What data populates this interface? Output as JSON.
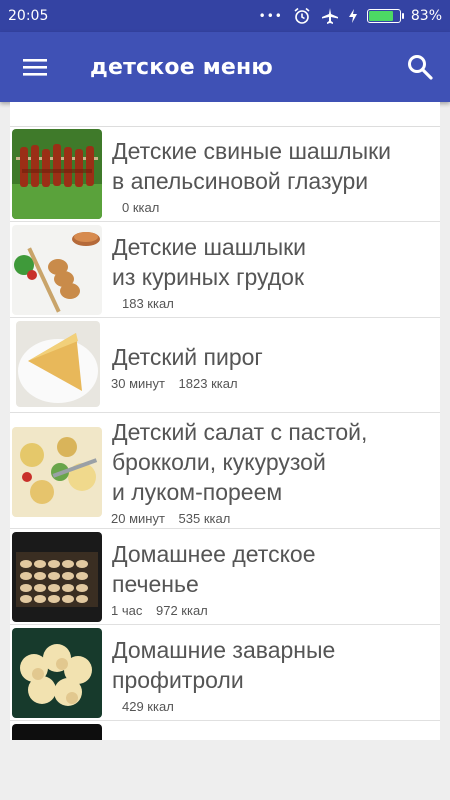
{
  "status": {
    "time": "20:05",
    "dots": "•••",
    "battery": "83%",
    "battery_level": 0.83
  },
  "appbar": {
    "title": "детское меню",
    "menu_icon": "hamburger-menu-icon",
    "search_icon": "search-icon"
  },
  "recipes": [
    {
      "name_line1": "Детские свиные шашлыки",
      "name_line2": "в апельсиновой глазури",
      "name_line3": "",
      "time": "",
      "kcal": "0 ккал"
    },
    {
      "name_line1": "Детские шашлыки",
      "name_line2": "из куриных грудок",
      "name_line3": "",
      "time": "",
      "kcal": "183 ккал"
    },
    {
      "name_line1": "Детский пирог",
      "name_line2": "",
      "name_line3": "",
      "time": "30 минут",
      "kcal": "1823 ккал"
    },
    {
      "name_line1": "Детский салат с пастой,",
      "name_line2": "брокколи, кукурузой",
      "name_line3": "и луком-пореем",
      "time": "20 минут",
      "kcal": "535 ккал"
    },
    {
      "name_line1": "Домашнее детское",
      "name_line2": "печенье",
      "name_line3": "",
      "time": "1 час",
      "kcal": "972 ккал"
    },
    {
      "name_line1": "Домашние заварные",
      "name_line2": "профитроли",
      "name_line3": "",
      "time": "",
      "kcal": "429 ккал"
    }
  ]
}
